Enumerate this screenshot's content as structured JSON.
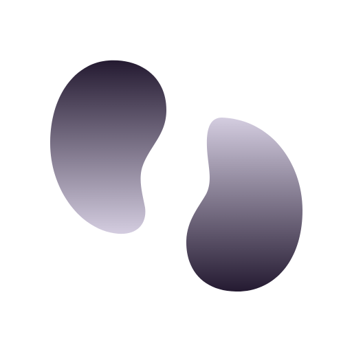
{
  "logo": {
    "name": "two-bean-shapes-mark",
    "colors": {
      "dark": "#241a31",
      "light": "#d4cde0",
      "background": "#ffffff"
    }
  }
}
